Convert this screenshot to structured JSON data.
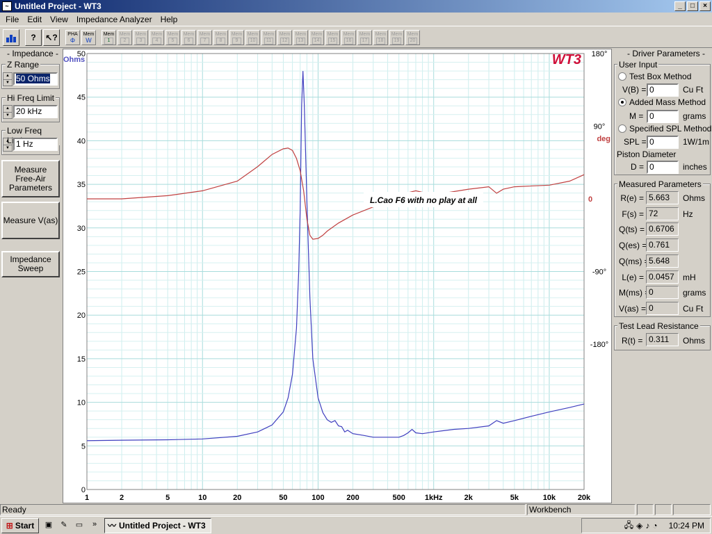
{
  "window": {
    "title": "Untitled Project - WT3",
    "minimize": "_",
    "maximize": "□",
    "close": "×"
  },
  "menu": [
    "File",
    "Edit",
    "View",
    "Impedance Analyzer",
    "Help"
  ],
  "toolbar": {
    "pha_label": "PHA",
    "pha_sub": "Φ",
    "memw_label": "Mem",
    "memw_sub": "W",
    "mem_label": "Mem",
    "mem_slots": [
      "1",
      "2",
      "3",
      "4",
      "5",
      "6",
      "7",
      "8",
      "9",
      "10",
      "11",
      "12",
      "13",
      "14",
      "15",
      "16",
      "17",
      "18",
      "19",
      "20"
    ]
  },
  "left": {
    "title": "- Impedance -",
    "z_range": {
      "label": "Z Range",
      "value": "50 Ohms"
    },
    "hi_freq": {
      "label": "Hi Freq Limit",
      "value": "20 kHz"
    },
    "low_freq": {
      "label": "Low Freq Limit",
      "value": "1 Hz"
    },
    "btn_free_air": "Measure\nFree-Air\nParameters",
    "btn_vas": "Measure V(as)",
    "btn_sweep": "Impedance\nSweep"
  },
  "chart_data": {
    "type": "line",
    "logo": "WT3",
    "annotation": "L.Cao F6 with no play at all",
    "ylabel_left": "Ohms",
    "ylabel_right": "deg",
    "x_scale": "log",
    "xlim": [
      1,
      20000
    ],
    "ylim": [
      0,
      50
    ],
    "y2lim": [
      -360,
      180
    ],
    "x_ticks": [
      "1",
      "2",
      "5",
      "10",
      "20",
      "50",
      "100",
      "200",
      "500",
      "1kHz",
      "2k",
      "5k",
      "10k",
      "20k"
    ],
    "y_ticks": [
      "0",
      "5",
      "10",
      "15",
      "20",
      "25",
      "30",
      "35",
      "40",
      "45",
      "50"
    ],
    "y2_ticks": [
      "180°",
      "90°",
      "0",
      "-90°",
      "-180°"
    ],
    "grid": true,
    "series": [
      {
        "name": "Impedance",
        "color": "#3f3fbf",
        "axis": "left",
        "x": [
          1,
          2,
          5,
          10,
          20,
          30,
          40,
          50,
          55,
          60,
          65,
          68,
          70,
          72,
          74,
          76,
          80,
          85,
          90,
          100,
          110,
          120,
          130,
          140,
          150,
          160,
          170,
          180,
          200,
          250,
          300,
          400,
          500,
          550,
          600,
          650,
          700,
          800,
          1000,
          1500,
          2000,
          3000,
          3500,
          4000,
          5000,
          7000,
          10000,
          15000,
          20000
        ],
        "y": [
          5.6,
          5.65,
          5.7,
          5.8,
          6.1,
          6.6,
          7.4,
          8.9,
          10.5,
          13.2,
          18.5,
          25,
          32,
          44,
          48,
          44,
          33,
          22,
          15,
          10.5,
          8.8,
          8,
          7.7,
          7.9,
          7.3,
          7.2,
          6.6,
          6.8,
          6.4,
          6.2,
          6.0,
          6.0,
          6.0,
          6.2,
          6.5,
          6.9,
          6.5,
          6.4,
          6.6,
          6.9,
          7.0,
          7.3,
          7.9,
          7.6,
          7.9,
          8.4,
          8.9,
          9.4,
          9.8
        ]
      },
      {
        "name": "Phase",
        "color": "#c04040",
        "axis": "right",
        "x": [
          1,
          2,
          5,
          10,
          20,
          30,
          40,
          50,
          55,
          60,
          65,
          70,
          75,
          80,
          85,
          90,
          100,
          110,
          120,
          150,
          200,
          300,
          500,
          700,
          1000,
          2000,
          3000,
          3500,
          4000,
          5000,
          10000,
          15000,
          20000
        ],
        "y": [
          0,
          0,
          4,
          10,
          22,
          40,
          55,
          62,
          63,
          60,
          50,
          35,
          10,
          -25,
          -45,
          -50,
          -49,
          -45,
          -40,
          -30,
          -20,
          -10,
          5,
          10,
          5,
          12,
          15,
          7,
          12,
          15,
          17,
          22,
          30
        ]
      }
    ]
  },
  "right": {
    "title": "- Driver Parameters -",
    "user_input": "User Input",
    "test_box": "Test Box Method",
    "vb_label": "V(B) =",
    "vb_value": "0",
    "vb_unit": "Cu Ft",
    "added_mass": "Added Mass Method",
    "m_label": "M =",
    "m_value": "0",
    "m_unit": "grams",
    "spl": "Specified SPL Method",
    "spl_label": "SPL =",
    "spl_value": "0",
    "spl_unit": "1W/1m",
    "piston": "Piston Diameter",
    "d_label": "D =",
    "d_value": "0",
    "d_unit": "inches",
    "measured": "Measured Parameters",
    "params": [
      {
        "label": "R(e) =",
        "value": "5.663",
        "unit": "Ohms"
      },
      {
        "label": "F(s) =",
        "value": "72",
        "unit": "Hz"
      },
      {
        "label": "Q(ts) =",
        "value": "0.6706",
        "unit": ""
      },
      {
        "label": "Q(es) =",
        "value": "0.761",
        "unit": ""
      },
      {
        "label": "Q(ms) =",
        "value": "5.648",
        "unit": ""
      },
      {
        "label": "L(e) =",
        "value": "0.0457",
        "unit": "mH"
      },
      {
        "label": "M(ms) =",
        "value": "0",
        "unit": "grams"
      },
      {
        "label": "V(as) =",
        "value": "0",
        "unit": "Cu Ft"
      }
    ],
    "lead": "Test Lead Resistance",
    "rt_label": "R(t) =",
    "rt_value": "0.311",
    "rt_unit": "Ohms"
  },
  "status": {
    "left": "Ready",
    "workbench": "Workbench"
  },
  "taskbar": {
    "start": "Start",
    "task": "Untitled Project - WT3",
    "chevron": "»",
    "clock": "10:24 PM"
  }
}
